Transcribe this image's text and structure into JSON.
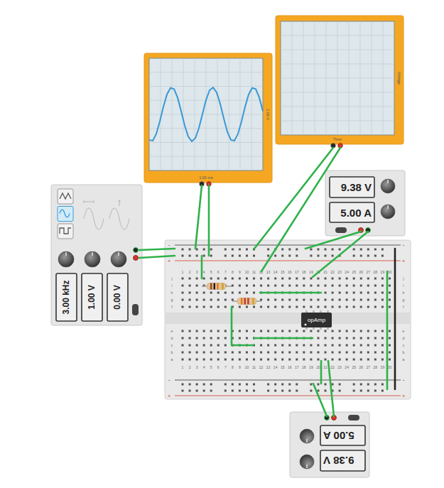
{
  "scopes": [
    {
      "x_label": "1.00 ms",
      "y_label": "2.00 V",
      "trace": [
        -0.946,
        -0.976,
        -0.722,
        -0.257,
        0.282,
        0.74,
        0.982,
        0.938,
        0.62,
        0.122,
        -0.412,
        -0.825,
        -0.999,
        -0.881,
        -0.508,
        0.014,
        0.531,
        0.894,
        0.997,
        0.809,
        0.386,
        -0.15,
        -0.641,
        -0.947,
        -0.976,
        -0.722,
        -0.257,
        0.282,
        0.74,
        0.982,
        0.938,
        0.62,
        0.122
      ]
    },
    {
      "x_label": "Time",
      "y_label": "Voltage",
      "trace": []
    }
  ],
  "function_generator": {
    "waveforms": [
      {
        "kind": "triangle",
        "selected": false
      },
      {
        "kind": "sine",
        "selected": true
      },
      {
        "kind": "square",
        "selected": false
      }
    ],
    "readouts": [
      "3.00 kHz",
      "1.00 V",
      "0.00 V"
    ]
  },
  "power_supplies": [
    {
      "voltage": "9.38 V",
      "current": "5.00 A"
    },
    {
      "voltage": "9.38 V",
      "current": "5.00 A"
    }
  ],
  "breadboard": {
    "columns": [
      "1",
      "2",
      "3",
      "4",
      "5",
      "6",
      "7",
      "8",
      "9",
      "10",
      "11",
      "12",
      "13",
      "14",
      "15",
      "16",
      "17",
      "18",
      "19",
      "20",
      "21",
      "22",
      "23",
      "24",
      "25",
      "26",
      "27",
      "28",
      "29",
      "30"
    ],
    "rows_top": [
      "j",
      "i",
      "h",
      "g",
      "f"
    ],
    "rows_bottom": [
      "e",
      "d",
      "c",
      "b",
      "a"
    ],
    "rail_signs": [
      "-",
      "+"
    ]
  },
  "opamp": {
    "label": "opAmp"
  },
  "resistors": [
    {
      "bands": [
        "#8b4a1c",
        "#1a1a1a",
        "#e07b1a",
        "#c9a227"
      ]
    },
    {
      "bands": [
        "#e07b1a",
        "#c0392b",
        "#c0392b",
        "#c9a227"
      ]
    }
  ]
}
